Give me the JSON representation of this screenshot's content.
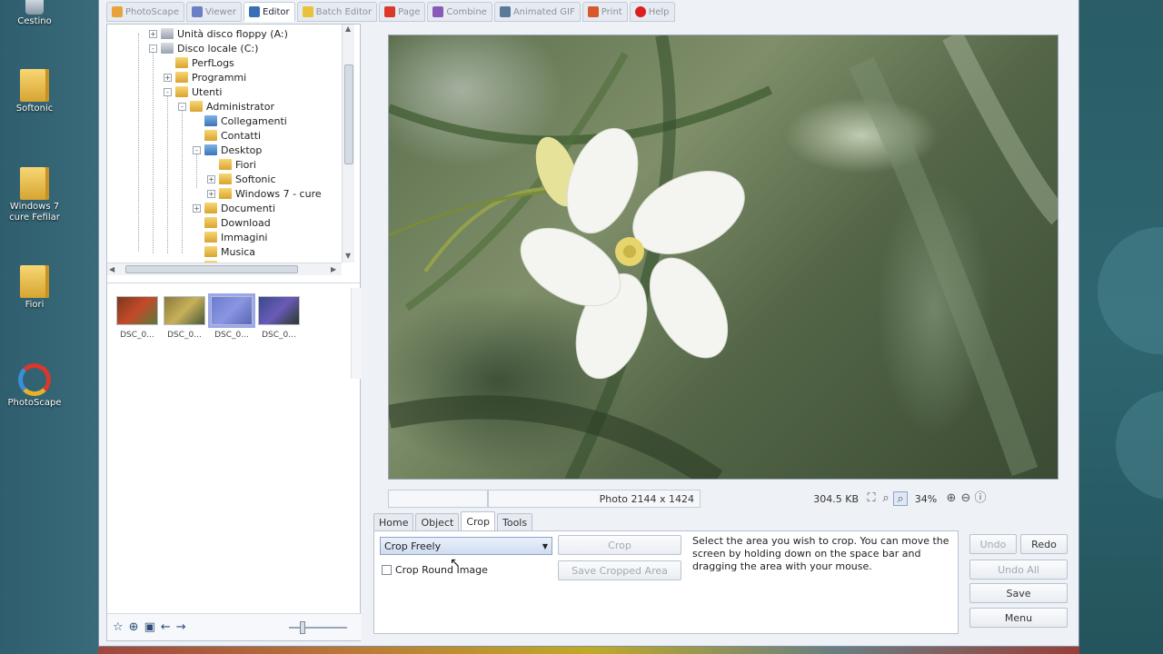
{
  "desktop": {
    "icons": [
      {
        "label": "Cestino",
        "icon": "recycle-bin-icon"
      },
      {
        "label": "Softonic",
        "icon": "folder-icon"
      },
      {
        "label": "Windows 7 cure Fefilar",
        "icon": "folder-icon"
      },
      {
        "label": "Fiori",
        "icon": "folder-icon"
      },
      {
        "label": "PhotoScape",
        "icon": "photoscape-app-icon"
      }
    ]
  },
  "top_tabs": [
    {
      "label": "PhotoScape",
      "icon": "home-icon",
      "active": false
    },
    {
      "label": "Viewer",
      "icon": "viewer-icon",
      "active": false
    },
    {
      "label": "Editor",
      "icon": "editor-icon",
      "active": true
    },
    {
      "label": "Batch Editor",
      "icon": "batch-icon",
      "active": false
    },
    {
      "label": "Page",
      "icon": "page-icon",
      "active": false
    },
    {
      "label": "Combine",
      "icon": "combine-icon",
      "active": false
    },
    {
      "label": "Animated GIF",
      "icon": "gif-icon",
      "active": false
    },
    {
      "label": "Print",
      "icon": "print-icon",
      "active": false
    },
    {
      "label": "Help",
      "icon": "help-icon",
      "active": false
    }
  ],
  "tree": [
    {
      "label": "Unità disco floppy (A:)",
      "icon": "floppy",
      "level": 0,
      "exp": "+"
    },
    {
      "label": "Disco locale (C:)",
      "icon": "drive",
      "level": 0,
      "exp": "-"
    },
    {
      "label": "PerfLogs",
      "icon": "folder",
      "level": 1,
      "exp": ""
    },
    {
      "label": "Programmi",
      "icon": "folder",
      "level": 1,
      "exp": "+"
    },
    {
      "label": "Utenti",
      "icon": "folder",
      "level": 1,
      "exp": "-"
    },
    {
      "label": "Administrator",
      "icon": "folder",
      "level": 2,
      "exp": "-"
    },
    {
      "label": "Collegamenti",
      "icon": "blue",
      "level": 3,
      "exp": ""
    },
    {
      "label": "Contatti",
      "icon": "folder",
      "level": 3,
      "exp": ""
    },
    {
      "label": "Desktop",
      "icon": "blue",
      "level": 3,
      "exp": "-"
    },
    {
      "label": "Fiori",
      "icon": "folder",
      "level": 4,
      "exp": ""
    },
    {
      "label": "Softonic",
      "icon": "folder",
      "level": 4,
      "exp": "+"
    },
    {
      "label": "Windows 7 - cure",
      "icon": "folder",
      "level": 4,
      "exp": "+"
    },
    {
      "label": "Documenti",
      "icon": "folder",
      "level": 3,
      "exp": "+"
    },
    {
      "label": "Download",
      "icon": "folder",
      "level": 3,
      "exp": ""
    },
    {
      "label": "Immagini",
      "icon": "folder",
      "level": 3,
      "exp": ""
    },
    {
      "label": "Musica",
      "icon": "folder",
      "level": 3,
      "exp": ""
    },
    {
      "label": "Partite salvate",
      "icon": "folder",
      "level": 3,
      "exp": ""
    }
  ],
  "thumbnails": [
    {
      "label": "DSC_0...",
      "colors": [
        "#7a3a1a",
        "#c44a2a",
        "#5a7a3a"
      ],
      "selected": false
    },
    {
      "label": "DSC_0...",
      "colors": [
        "#8a7a3a",
        "#c8b05a",
        "#4a5a3a"
      ],
      "selected": false
    },
    {
      "label": "DSC_0...",
      "colors": [
        "#6a7ad0",
        "#8a96e0",
        "#5a66b8"
      ],
      "selected": true
    },
    {
      "label": "DSC_0...",
      "colors": [
        "#3a4a8a",
        "#6a5ab8",
        "#2a3a2a"
      ],
      "selected": false
    }
  ],
  "status": {
    "photo_size": "Photo 2144 x 1424",
    "file_size": "304.5 KB",
    "zoom": "34%"
  },
  "tool_tabs": [
    {
      "label": "Home",
      "active": false
    },
    {
      "label": "Object",
      "active": false
    },
    {
      "label": "Crop",
      "active": true
    },
    {
      "label": "Tools",
      "active": false
    }
  ],
  "crop": {
    "mode_value": "Crop Freely",
    "crop_button": "Crop",
    "save_cropped_button": "Save Cropped Area",
    "round_label": "Crop Round Image",
    "instructions": "Select the area you wish to crop. You can move the screen by holding down on the space bar and dragging the area with your mouse."
  },
  "actions": {
    "undo": "Undo",
    "redo": "Redo",
    "undo_all": "Undo All",
    "save": "Save",
    "menu": "Menu"
  }
}
